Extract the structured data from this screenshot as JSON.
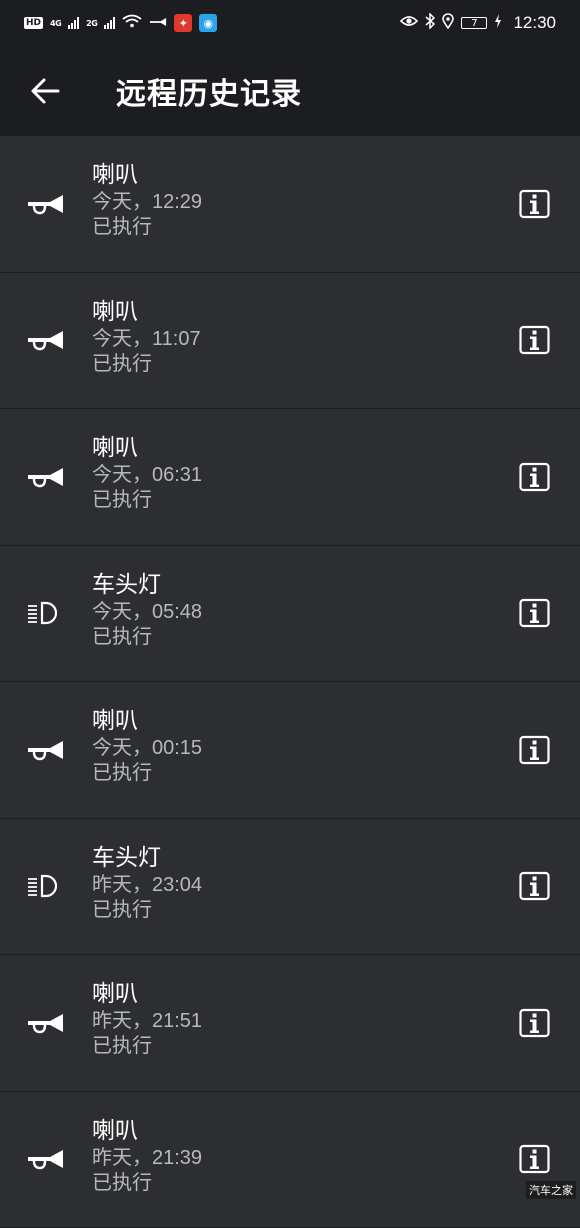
{
  "status_bar": {
    "hd": "HD",
    "sim1": "4G",
    "sim2": "2G",
    "battery_level": "7",
    "clock": "12:30"
  },
  "header": {
    "title": "远程历史记录"
  },
  "records": [
    {
      "name": "喇叭",
      "time": "今天，12:29",
      "status": "已执行",
      "icon": "horn-icon"
    },
    {
      "name": "喇叭",
      "time": "今天，11:07",
      "status": "已执行",
      "icon": "horn-icon"
    },
    {
      "name": "喇叭",
      "time": "今天，06:31",
      "status": "已执行",
      "icon": "horn-icon"
    },
    {
      "name": "车头灯",
      "time": "今天，05:48",
      "status": "已执行",
      "icon": "headlight-icon"
    },
    {
      "name": "喇叭",
      "time": "今天，00:15",
      "status": "已执行",
      "icon": "horn-icon"
    },
    {
      "name": "车头灯",
      "time": "昨天，23:04",
      "status": "已执行",
      "icon": "headlight-icon"
    },
    {
      "name": "喇叭",
      "time": "昨天，21:51",
      "status": "已执行",
      "icon": "horn-icon"
    },
    {
      "name": "喇叭",
      "time": "昨天，21:39",
      "status": "已执行",
      "icon": "horn-icon"
    }
  ],
  "watermark": "汽车之家",
  "colors": {
    "background": "#2d2e31",
    "header": "#1c1d20",
    "secondary_text": "#b8b9bc"
  }
}
